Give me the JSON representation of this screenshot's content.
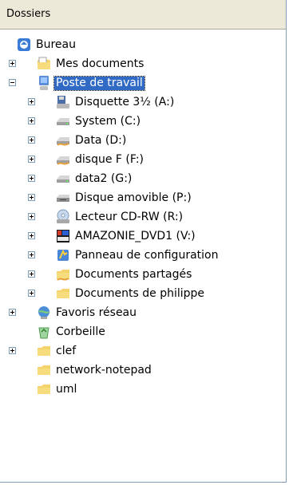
{
  "header": {
    "title": "Dossiers"
  },
  "tree": {
    "bureau": "Bureau",
    "mes_documents": "Mes documents",
    "poste_de_travail": "Poste de travail",
    "disquette": "Disquette 3½ (A:)",
    "system": "System (C:)",
    "data": "Data (D:)",
    "disque_f": "disque F (F:)",
    "data2": "data2 (G:)",
    "disque_amovible": "Disque amovible (P:)",
    "lecteur_cd": "Lecteur CD-RW (R:)",
    "amazonie": "AMAZONIE_DVD1 (V:)",
    "panneau": "Panneau de configuration",
    "documents_partages": "Documents partagés",
    "documents_philippe": "Documents de philippe",
    "favoris_reseau": "Favoris réseau",
    "corbeille": "Corbeille",
    "clef": "clef",
    "network_notepad": "network-notepad",
    "uml": "uml"
  },
  "colors": {
    "selection": "#316ac5",
    "header_bg": "#ece9d8",
    "folder": "#f3d36b"
  }
}
